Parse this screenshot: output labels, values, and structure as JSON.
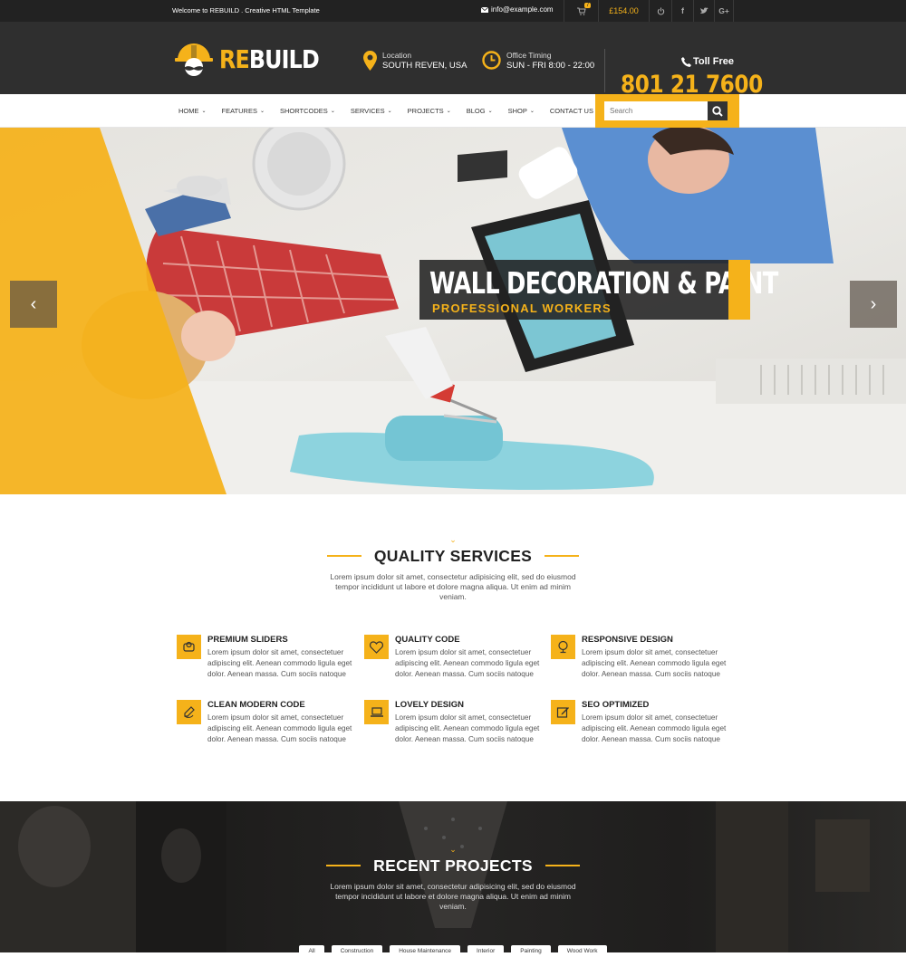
{
  "topbar": {
    "welcome": "Welcome to REBUILD . Creative HTML Template",
    "email": "info@example.com",
    "cart_count": "7",
    "cart_total": "£154.00"
  },
  "header": {
    "logo_re": "RE",
    "logo_build": "BUILD",
    "location_label": "Location",
    "location_value": "SOUTH REVEN, USA",
    "timing_label": "Office Timing",
    "timing_value": "SUN - FRI 8:00 - 22:00",
    "tollfree_label": "Toll Free",
    "phone": "801 21 7600"
  },
  "nav": {
    "items": [
      {
        "label": "HOME"
      },
      {
        "label": "FEATURES"
      },
      {
        "label": "SHORTCODES"
      },
      {
        "label": "SERVICES"
      },
      {
        "label": "PROJECTS"
      },
      {
        "label": "BLOG"
      },
      {
        "label": "SHOP"
      },
      {
        "label": "CONTACT US"
      }
    ],
    "search_placeholder": "Search"
  },
  "hero": {
    "title": "WALL DECORATION & PAINT",
    "subtitle": "PROFESSIONAL WORKERS"
  },
  "services": {
    "title": "QUALITY SERVICES",
    "intro": "Lorem ipsum dolor sit amet, consectetur adipisicing elit, sed do eiusmod tempor incididunt ut labore et dolore magna aliqua. Ut enim ad minim veniam.",
    "items": [
      {
        "title": "PREMIUM SLIDERS",
        "icon": "slider-icon",
        "text": "Lorem ipsum dolor sit amet, consectetuer adipiscing elit. Aenean commodo ligula eget dolor. Aenean massa. Cum sociis natoque"
      },
      {
        "title": "QUALITY CODE",
        "icon": "heart-icon",
        "text": "Lorem ipsum dolor sit amet, consectetuer adipiscing elit. Aenean commodo ligula eget dolor. Aenean massa. Cum sociis natoque"
      },
      {
        "title": "RESPONSIVE DESIGN",
        "icon": "globe-icon",
        "text": "Lorem ipsum dolor sit amet, consectetuer adipiscing elit. Aenean commodo ligula eget dolor. Aenean massa. Cum sociis natoque"
      },
      {
        "title": "CLEAN MODERN CODE",
        "icon": "pen-icon",
        "text": "Lorem ipsum dolor sit amet, consectetuer adipiscing elit. Aenean commodo ligula eget dolor. Aenean massa. Cum sociis natoque"
      },
      {
        "title": "LOVELY DESIGN",
        "icon": "laptop-icon",
        "text": "Lorem ipsum dolor sit amet, consectetuer adipiscing elit. Aenean commodo ligula eget dolor. Aenean massa. Cum sociis natoque"
      },
      {
        "title": "SEO OPTIMIZED",
        "icon": "edit-icon",
        "text": "Lorem ipsum dolor sit amet, consectetuer adipiscing elit. Aenean commodo ligula eget dolor. Aenean massa. Cum sociis natoque"
      }
    ]
  },
  "projects": {
    "title": "RECENT PROJECTS",
    "intro": "Lorem ipsum dolor sit amet, consectetur adipisicing elit, sed do eiusmod tempor incididunt ut labore et dolore magna aliqua. Ut enim ad minim veniam.",
    "filters": [
      "All",
      "Construction",
      "House Maintenance",
      "Interior",
      "Painting",
      "Wood Work"
    ]
  },
  "colors": {
    "accent": "#f5b21a",
    "dark": "#2f2f2f",
    "topbar": "#222222"
  }
}
